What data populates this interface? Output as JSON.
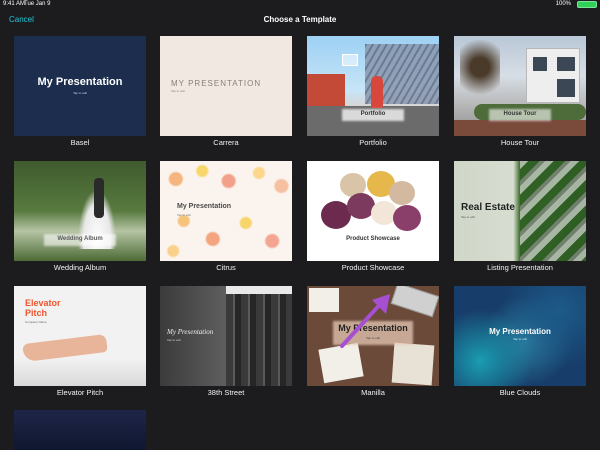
{
  "status_bar": {
    "time": "9:41 AM",
    "date": "Tue Jan 9",
    "battery_pct": "100%",
    "battery_icon": "battery-icon"
  },
  "nav": {
    "cancel_label": "Cancel",
    "title": "Choose a Template"
  },
  "templates": [
    {
      "name": "Basel",
      "title": "My Presentation",
      "subtitle": "Tap to edit"
    },
    {
      "name": "Carrera",
      "title": "MY PRESENTATION",
      "subtitle": "Tap to edit"
    },
    {
      "name": "Portfolio",
      "title": "Portfolio"
    },
    {
      "name": "House Tour",
      "title": "House Tour"
    },
    {
      "name": "Wedding Album",
      "title": "Wedding Album"
    },
    {
      "name": "Citrus",
      "title": "My Presentation",
      "subtitle": "Tap to edit"
    },
    {
      "name": "Product Showcase",
      "title": "Product Showcase"
    },
    {
      "name": "Listing Presentation",
      "title": "Real Estate",
      "subtitle": "Tap to edit"
    },
    {
      "name": "Elevator Pitch",
      "title": "Elevator\nPitch",
      "subtitle": "Company Name"
    },
    {
      "name": "38th Street",
      "title": "My Presentation",
      "subtitle": "Tap to edit"
    },
    {
      "name": "Manilla",
      "title": "My Presentation",
      "subtitle": "Tap to edit"
    },
    {
      "name": "Blue Clouds",
      "title": "My Presentation",
      "subtitle": "Tap to edit"
    }
  ],
  "colors": {
    "background": "#1c1c1e",
    "accent": "#21c7d9",
    "annotation_arrow": "#a64fd1"
  }
}
